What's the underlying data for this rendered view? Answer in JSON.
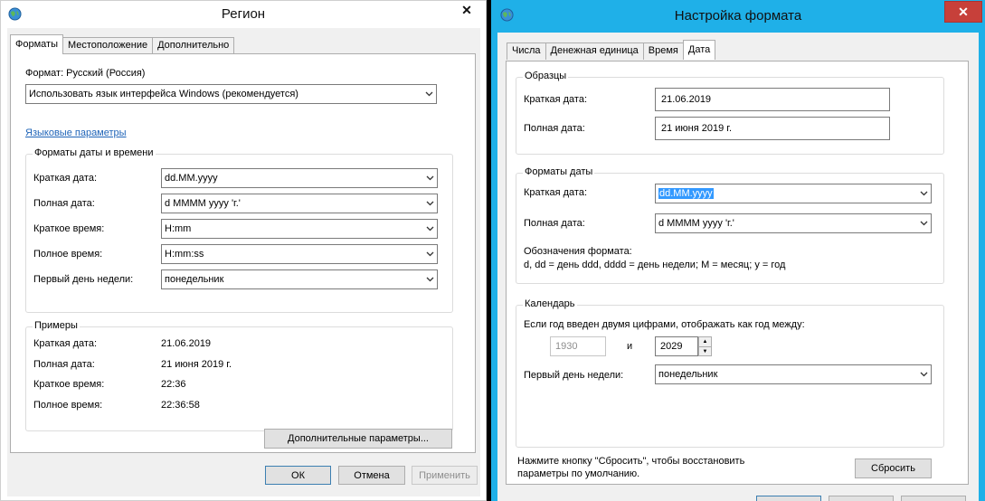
{
  "colors": {
    "accent": "#1fb0e8",
    "close_red": "#c7403a",
    "selection": "#3399ff",
    "link": "#1f64b8"
  },
  "region": {
    "title": "Регион",
    "icon": "globe-icon",
    "close_glyph": "✕",
    "tabs": [
      "Форматы",
      "Местоположение",
      "Дополнительно"
    ],
    "format_label": "Формат: Русский (Россия)",
    "format_value": "Использовать язык интерфейса Windows (рекомендуется)",
    "language_link": "Языковые параметры",
    "datetime_group": "Форматы даты и времени",
    "datetime_rows": [
      {
        "label": "Краткая дата:",
        "value": "dd.MM.yyyy"
      },
      {
        "label": "Полная дата:",
        "value": "d MMMM yyyy 'г.'"
      },
      {
        "label": "Краткое время:",
        "value": "H:mm"
      },
      {
        "label": "Полное время:",
        "value": "H:mm:ss"
      },
      {
        "label": "Первый день недели:",
        "value": "понедельник"
      }
    ],
    "examples_group": "Примеры",
    "examples": [
      {
        "label": "Краткая дата:",
        "value": "21.06.2019"
      },
      {
        "label": "Полная дата:",
        "value": "21 июня 2019 г."
      },
      {
        "label": "Краткое время:",
        "value": "22:36"
      },
      {
        "label": "Полное время:",
        "value": "22:36:58"
      }
    ],
    "advanced_button": "Дополнительные параметры...",
    "ok": "ОК",
    "cancel": "Отмена",
    "apply": "Применить"
  },
  "format": {
    "title": "Настройка формата",
    "icon": "globe-icon",
    "close_glyph": "✕",
    "tabs": [
      "Числа",
      "Денежная единица",
      "Время",
      "Дата"
    ],
    "samples_group": "Образцы",
    "samples": [
      {
        "label": "Краткая дата:",
        "value": "21.06.2019"
      },
      {
        "label": "Полная дата:",
        "value": "21 июня 2019 г."
      }
    ],
    "formats_group": "Форматы даты",
    "short_label": "Краткая дата:",
    "short_value": "dd.MM.yyyy",
    "long_label": "Полная дата:",
    "long_value": "d MMMM yyyy 'г.'",
    "notation_title": "Обозначения формата:",
    "notation_text": "d, dd = день  ddd, dddd = день недели; M = месяц; y = год",
    "calendar_group": "Календарь",
    "two_digit_text": "Если год введен двумя цифрами, отображать как год между:",
    "year_from": "1930",
    "and": "и",
    "year_to": "2029",
    "first_day_label": "Первый день недели:",
    "first_day_value": "понедельник",
    "reset_note_1": "Нажмите кнопку \"Сбросить\", чтобы восстановить",
    "reset_note_2": "параметры по умолчанию.",
    "reset_button": "Сбросить"
  }
}
